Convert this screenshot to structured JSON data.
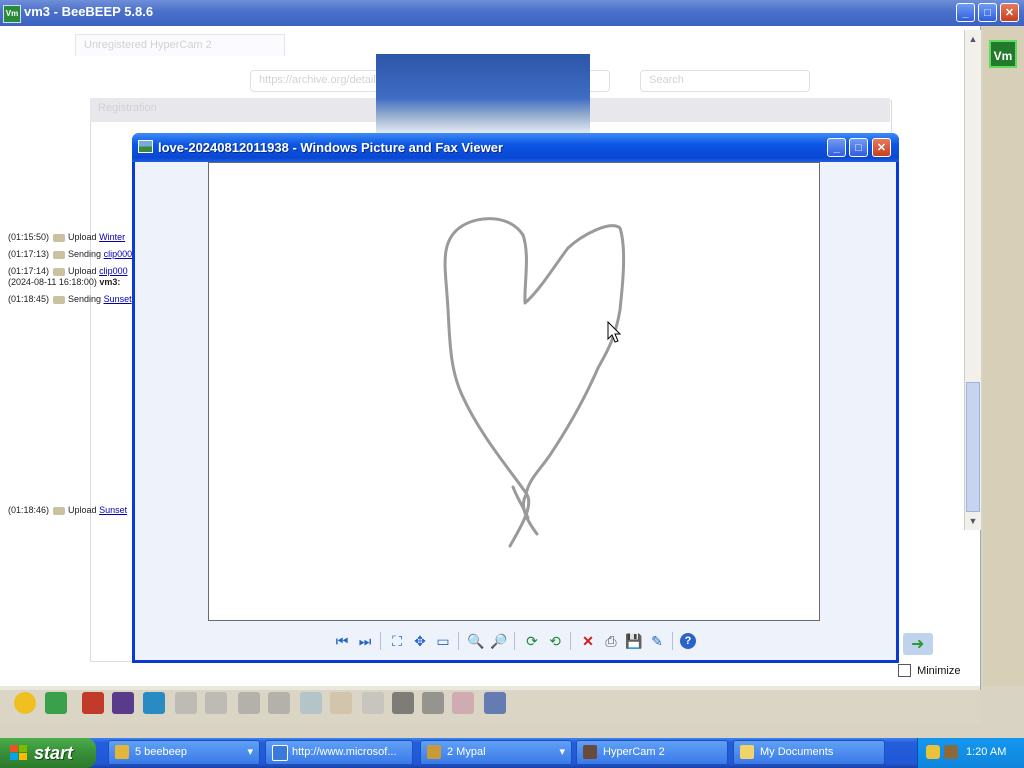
{
  "background_window": {
    "icon_label": "Vm",
    "title": "vm3 - BeeBEEP 5.8.6",
    "controls": {
      "minimize": "_",
      "maximize": "□",
      "close": "✕"
    }
  },
  "ghost_browser": {
    "tab_title": "Unregistered HyperCam 2",
    "url": "https://archive.org/details/Sunset-glow",
    "search_placeholder": "Search",
    "panel_title": "Registration"
  },
  "chat_log": [
    {
      "time": "(01:15:50)",
      "action": "Upload",
      "target": "Winter"
    },
    {
      "time": "(01:17:13)",
      "action": "Sending",
      "target": "clip000"
    },
    {
      "time": "(01:17:14)",
      "action": "Upload",
      "target": "clip000"
    },
    {
      "time": "(2024-08-11 16:18:00)",
      "action": "vm3:",
      "target": ""
    },
    {
      "time": "(01:18:45)",
      "action": "Sending",
      "target": "Sunset"
    },
    {
      "time": "(01:18:46)",
      "action": "Upload",
      "target": "Sunset"
    }
  ],
  "right_strip": {
    "app_icon": "Vm",
    "minimize_label": "Minimize"
  },
  "viewer": {
    "title": "love-20240812011938 - Windows Picture and Fax Viewer",
    "toolbar": [
      {
        "icon": "previous-image-icon",
        "glyph": "⏮"
      },
      {
        "icon": "next-image-icon",
        "glyph": "⏭"
      },
      {
        "icon": "best-fit-icon",
        "glyph": "⛶"
      },
      {
        "icon": "actual-size-icon",
        "glyph": "✥"
      },
      {
        "icon": "slideshow-icon",
        "glyph": "▭"
      },
      {
        "icon": "zoom-in-icon",
        "glyph": "🔍"
      },
      {
        "icon": "zoom-out-icon",
        "glyph": "🔎"
      },
      {
        "icon": "rotate-clockwise-icon",
        "glyph": "⟳"
      },
      {
        "icon": "rotate-counterclockwise-icon",
        "glyph": "⟲"
      },
      {
        "icon": "delete-icon",
        "glyph": "✕"
      },
      {
        "icon": "print-icon",
        "glyph": "⎙"
      },
      {
        "icon": "save-icon",
        "glyph": "💾"
      },
      {
        "icon": "edit-icon",
        "glyph": "✎"
      },
      {
        "icon": "help-icon",
        "glyph": "?"
      }
    ]
  },
  "taskbar": {
    "start_label": "start",
    "tasks": [
      {
        "label": "5 beebeep",
        "icon": "beebeep-icon"
      },
      {
        "label": "http://www.microsof...",
        "icon": "internet-explorer-icon"
      },
      {
        "label": "2 Mypal",
        "icon": "mypal-icon"
      },
      {
        "label": "HyperCam 2",
        "icon": "hypercam-icon"
      },
      {
        "label": "My Documents",
        "icon": "folder-icon"
      }
    ],
    "clock": "1:20 AM"
  },
  "colors": {
    "titlebar": "#0a48d3",
    "taskbar": "#245edb",
    "start": "#388e38"
  }
}
